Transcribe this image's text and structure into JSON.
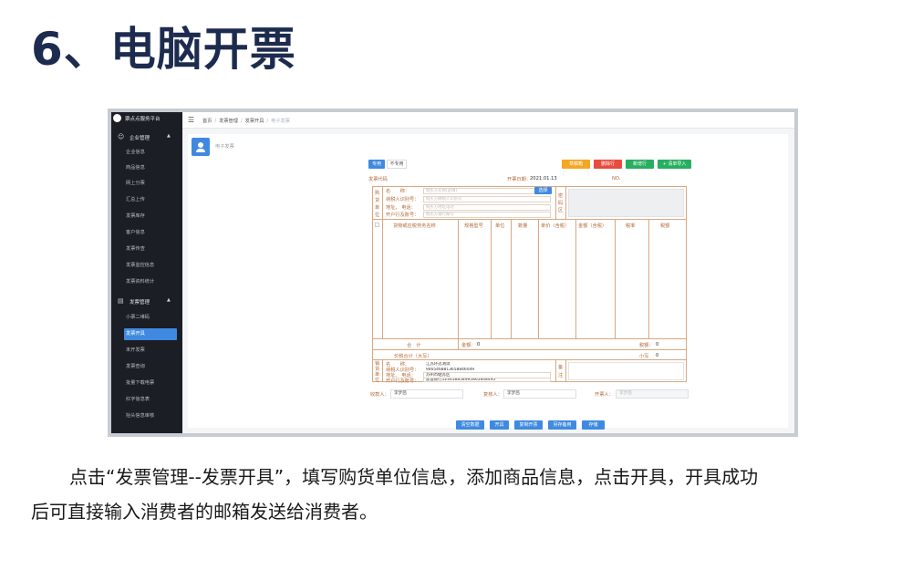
{
  "page": {
    "title": "6、电脑开票",
    "caption_line1": "点击“发票管理--发票开具”，填写购货单位信息，添加商品信息，点击开具，开具成功",
    "caption_line2": "后可直接输入消费者的邮箱发送给消费者。"
  },
  "app": {
    "name": "票点点服务平台",
    "sidebar": {
      "group_enterprise": "企业管理",
      "enterprise_items": [
        "企业信息",
        "商品信息",
        "网上分票",
        "汇总上传",
        "发票库存",
        "客户信息",
        "发票传查",
        "发票监控信息",
        "发票资料统计"
      ],
      "group_invoice": "发票管理",
      "invoice_items": [
        "小票二维码",
        "发票开具",
        "未开发票",
        "发票查询",
        "批量下载电票",
        "红字信息表",
        "抬头信息审核"
      ],
      "active_item": "发票开具"
    },
    "breadcrumb": [
      "首页",
      "发票管理",
      "发票开具",
      "电子发票"
    ]
  },
  "invoice": {
    "card_title": "电子发票",
    "tab_special": "专用",
    "tab_normal": "不专用",
    "action_buttons": {
      "draft": "草稿箱",
      "delete_row": "删除行",
      "add_row": "新增行",
      "import_list": "+ 清单导入"
    },
    "code_label": "发票代码",
    "date_label": "开票日期：",
    "date_value": "2021.01.13",
    "no_label": "NO.",
    "buyer": {
      "section_label": [
        "购",
        "货",
        "单",
        "位"
      ],
      "name_label": "名　　称：",
      "name_placeholder": "购买方名称(必填)",
      "select_button": "选择",
      "tax_label": "纳税人识别号：",
      "tax_placeholder": "购买方纳税人识别号",
      "addr_label": "地址、 电话：",
      "addr_placeholder": "购买方地址电话",
      "bank_label": "开户行及账号：",
      "bank_placeholder": "购买方银行账号",
      "secret_label": [
        "密",
        "码",
        "区"
      ]
    },
    "table_headers": [
      "货物或应税劳务名称",
      "规格型号",
      "单位",
      "数量",
      "单价（含税）",
      "金额（含税）",
      "税率",
      "税额"
    ],
    "total_label": "合　计",
    "amount_label": "金额：",
    "amount_value": "0",
    "tax_total_label": "税额：",
    "tax_total_value": "0",
    "grand_total_label": "价税合计（大写）",
    "grand_small_label": "小写",
    "grand_small_value": "0",
    "seller": {
      "section_label": [
        "销",
        "货",
        "单",
        "位"
      ],
      "name_label": "名　　称：",
      "name_value": "江苏环迅测试",
      "tax_label": "纳税人识别号：",
      "tax_value": "9465468813658846049",
      "addr_label": "地址、 电话：",
      "addr_value": "苏州市姑苏区",
      "bank_label": "开户行及账号：",
      "bank_value": "建设银行123458858995865848495",
      "remark_label": [
        "备",
        "注"
      ]
    },
    "payee_label": "收款人：",
    "payee_value": "李梦茜",
    "reviewer_label": "复核人：",
    "reviewer_value": "李梦茜",
    "drawer_label": "开票人：",
    "drawer_value": "李梦茜",
    "bottom_buttons": [
      "清空数据",
      "开具",
      "复制开票",
      "另存备用",
      "存储"
    ]
  },
  "colors": {
    "title": "#1d2b4f",
    "sidebar_bg": "#1b1e24",
    "accent": "#3f8ae0",
    "invoice_line": "#d9a77f",
    "invoice_label": "#b06a3a"
  }
}
